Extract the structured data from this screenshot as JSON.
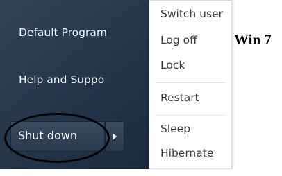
{
  "start_pane": {
    "items": [
      {
        "label": "Default Program"
      },
      {
        "label": "Help and Suppo"
      }
    ],
    "shutdown_label": "Shut down"
  },
  "power_menu": {
    "items": [
      {
        "label": "Switch user"
      },
      {
        "label": "Log off"
      },
      {
        "label": "Lock"
      },
      {
        "label": "Restart"
      },
      {
        "label": "Sleep"
      },
      {
        "label": "Hibernate"
      }
    ]
  },
  "annotation": {
    "label": "Win 7"
  },
  "icons": {
    "arrow": "chevron-right-icon"
  }
}
